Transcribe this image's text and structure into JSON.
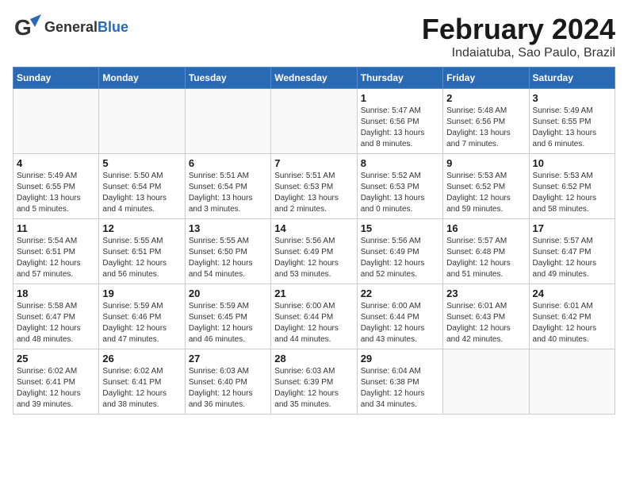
{
  "header": {
    "logo_general": "General",
    "logo_blue": "Blue",
    "month": "February 2024",
    "location": "Indaiatuba, Sao Paulo, Brazil"
  },
  "days_of_week": [
    "Sunday",
    "Monday",
    "Tuesday",
    "Wednesday",
    "Thursday",
    "Friday",
    "Saturday"
  ],
  "weeks": [
    [
      {
        "day": "",
        "info": ""
      },
      {
        "day": "",
        "info": ""
      },
      {
        "day": "",
        "info": ""
      },
      {
        "day": "",
        "info": ""
      },
      {
        "day": "1",
        "info": "Sunrise: 5:47 AM\nSunset: 6:56 PM\nDaylight: 13 hours and 8 minutes."
      },
      {
        "day": "2",
        "info": "Sunrise: 5:48 AM\nSunset: 6:56 PM\nDaylight: 13 hours and 7 minutes."
      },
      {
        "day": "3",
        "info": "Sunrise: 5:49 AM\nSunset: 6:55 PM\nDaylight: 13 hours and 6 minutes."
      }
    ],
    [
      {
        "day": "4",
        "info": "Sunrise: 5:49 AM\nSunset: 6:55 PM\nDaylight: 13 hours and 5 minutes."
      },
      {
        "day": "5",
        "info": "Sunrise: 5:50 AM\nSunset: 6:54 PM\nDaylight: 13 hours and 4 minutes."
      },
      {
        "day": "6",
        "info": "Sunrise: 5:51 AM\nSunset: 6:54 PM\nDaylight: 13 hours and 3 minutes."
      },
      {
        "day": "7",
        "info": "Sunrise: 5:51 AM\nSunset: 6:53 PM\nDaylight: 13 hours and 2 minutes."
      },
      {
        "day": "8",
        "info": "Sunrise: 5:52 AM\nSunset: 6:53 PM\nDaylight: 13 hours and 0 minutes."
      },
      {
        "day": "9",
        "info": "Sunrise: 5:53 AM\nSunset: 6:52 PM\nDaylight: 12 hours and 59 minutes."
      },
      {
        "day": "10",
        "info": "Sunrise: 5:53 AM\nSunset: 6:52 PM\nDaylight: 12 hours and 58 minutes."
      }
    ],
    [
      {
        "day": "11",
        "info": "Sunrise: 5:54 AM\nSunset: 6:51 PM\nDaylight: 12 hours and 57 minutes."
      },
      {
        "day": "12",
        "info": "Sunrise: 5:55 AM\nSunset: 6:51 PM\nDaylight: 12 hours and 56 minutes."
      },
      {
        "day": "13",
        "info": "Sunrise: 5:55 AM\nSunset: 6:50 PM\nDaylight: 12 hours and 54 minutes."
      },
      {
        "day": "14",
        "info": "Sunrise: 5:56 AM\nSunset: 6:49 PM\nDaylight: 12 hours and 53 minutes."
      },
      {
        "day": "15",
        "info": "Sunrise: 5:56 AM\nSunset: 6:49 PM\nDaylight: 12 hours and 52 minutes."
      },
      {
        "day": "16",
        "info": "Sunrise: 5:57 AM\nSunset: 6:48 PM\nDaylight: 12 hours and 51 minutes."
      },
      {
        "day": "17",
        "info": "Sunrise: 5:57 AM\nSunset: 6:47 PM\nDaylight: 12 hours and 49 minutes."
      }
    ],
    [
      {
        "day": "18",
        "info": "Sunrise: 5:58 AM\nSunset: 6:47 PM\nDaylight: 12 hours and 48 minutes."
      },
      {
        "day": "19",
        "info": "Sunrise: 5:59 AM\nSunset: 6:46 PM\nDaylight: 12 hours and 47 minutes."
      },
      {
        "day": "20",
        "info": "Sunrise: 5:59 AM\nSunset: 6:45 PM\nDaylight: 12 hours and 46 minutes."
      },
      {
        "day": "21",
        "info": "Sunrise: 6:00 AM\nSunset: 6:44 PM\nDaylight: 12 hours and 44 minutes."
      },
      {
        "day": "22",
        "info": "Sunrise: 6:00 AM\nSunset: 6:44 PM\nDaylight: 12 hours and 43 minutes."
      },
      {
        "day": "23",
        "info": "Sunrise: 6:01 AM\nSunset: 6:43 PM\nDaylight: 12 hours and 42 minutes."
      },
      {
        "day": "24",
        "info": "Sunrise: 6:01 AM\nSunset: 6:42 PM\nDaylight: 12 hours and 40 minutes."
      }
    ],
    [
      {
        "day": "25",
        "info": "Sunrise: 6:02 AM\nSunset: 6:41 PM\nDaylight: 12 hours and 39 minutes."
      },
      {
        "day": "26",
        "info": "Sunrise: 6:02 AM\nSunset: 6:41 PM\nDaylight: 12 hours and 38 minutes."
      },
      {
        "day": "27",
        "info": "Sunrise: 6:03 AM\nSunset: 6:40 PM\nDaylight: 12 hours and 36 minutes."
      },
      {
        "day": "28",
        "info": "Sunrise: 6:03 AM\nSunset: 6:39 PM\nDaylight: 12 hours and 35 minutes."
      },
      {
        "day": "29",
        "info": "Sunrise: 6:04 AM\nSunset: 6:38 PM\nDaylight: 12 hours and 34 minutes."
      },
      {
        "day": "",
        "info": ""
      },
      {
        "day": "",
        "info": ""
      }
    ]
  ]
}
